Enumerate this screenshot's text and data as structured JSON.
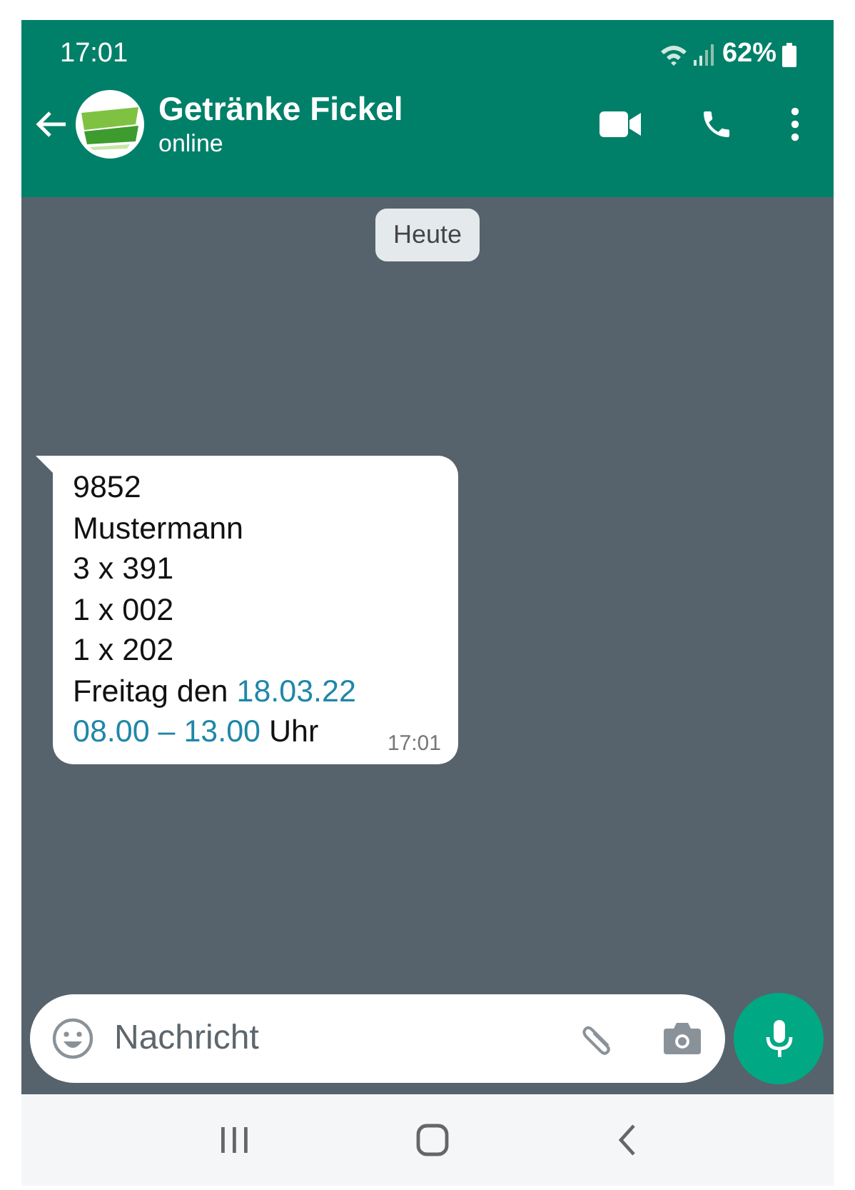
{
  "status_bar": {
    "time": "17:01",
    "battery": "62%"
  },
  "header": {
    "title": "Getränke Fickel",
    "subtitle": "online"
  },
  "date_chip": "Heute",
  "message": {
    "lines": [
      [
        {
          "text": "9852",
          "link": false
        }
      ],
      [
        {
          "text": "Mustermann",
          "link": false
        }
      ],
      [
        {
          "text": "3 x 391",
          "link": false
        }
      ],
      [
        {
          "text": "1 x 002",
          "link": false
        }
      ],
      [
        {
          "text": "1 x 202",
          "link": false
        }
      ],
      [
        {
          "text": "Freitag den ",
          "link": false
        },
        {
          "text": "18.03.22",
          "link": true
        }
      ],
      [
        {
          "text": "08.00 – 13.00",
          "link": true
        },
        {
          "text": " Uhr",
          "link": false
        }
      ]
    ],
    "time": "17:01"
  },
  "composer": {
    "placeholder": "Nachricht"
  }
}
